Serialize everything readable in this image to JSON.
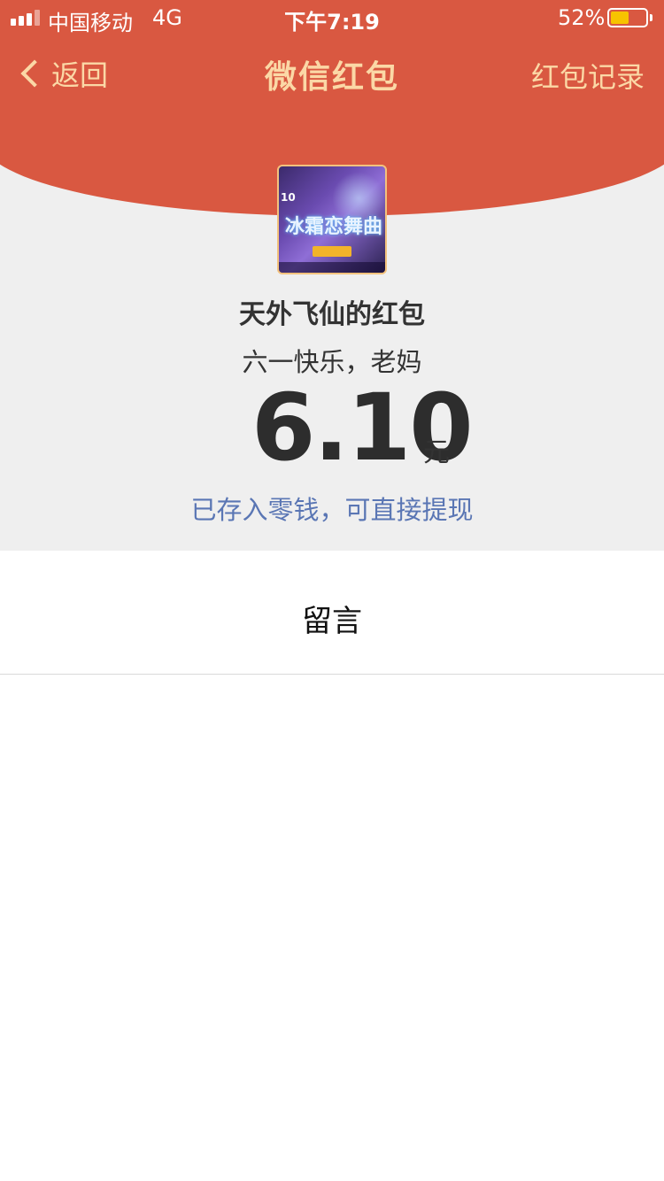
{
  "status_bar": {
    "carrier": "中国移动",
    "network": "4G",
    "time": "下午7:19",
    "battery": "52%",
    "battery_level": 0.52
  },
  "nav": {
    "back_label": "返回",
    "title": "微信红包",
    "right_label": "红包记录"
  },
  "avatar": {
    "title_text": "冰霜恋舞曲",
    "badge": "10"
  },
  "red_packet": {
    "sender": "天外飞仙的红包",
    "blessing": "六一快乐，老妈",
    "amount": "6.10",
    "unit": "元",
    "deposit_note": "已存入零钱，可直接提现"
  },
  "reply": {
    "label": "留言"
  },
  "colors": {
    "header_red": "#d95841",
    "nav_text": "#fbd8a6",
    "link_blue": "#5a76b4",
    "battery_fill": "#f7c300"
  }
}
